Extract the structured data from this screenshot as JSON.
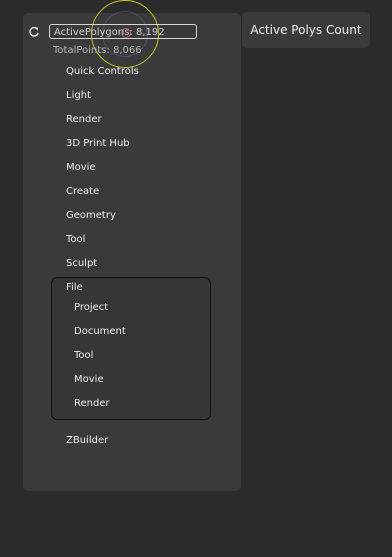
{
  "stats": {
    "active_polygons": "ActivePolygons: 8,192",
    "total_points": "TotalPoints: 8,066"
  },
  "menu": {
    "items": [
      {
        "label": "Quick Controls"
      },
      {
        "label": "Light"
      },
      {
        "label": "Render"
      },
      {
        "label": "3D Print Hub"
      },
      {
        "label": "Movie"
      },
      {
        "label": "Create"
      },
      {
        "label": "Geometry"
      },
      {
        "label": "Tool"
      },
      {
        "label": "Sculpt"
      }
    ],
    "file": {
      "label": "File",
      "subitems": [
        {
          "label": "Project"
        },
        {
          "label": "Document"
        },
        {
          "label": "Tool"
        },
        {
          "label": "Movie"
        },
        {
          "label": "Render"
        }
      ]
    },
    "last_item": {
      "label": "ZBuilder"
    }
  },
  "badge": {
    "label": "Active Polys Count"
  },
  "icons": {
    "refresh": "refresh-icon",
    "gizmo": "gizmo-icon"
  },
  "colors": {
    "background": "#2b2b2b",
    "panel": "#3a3a3a",
    "gizmo_ring": "#c9c22a"
  }
}
